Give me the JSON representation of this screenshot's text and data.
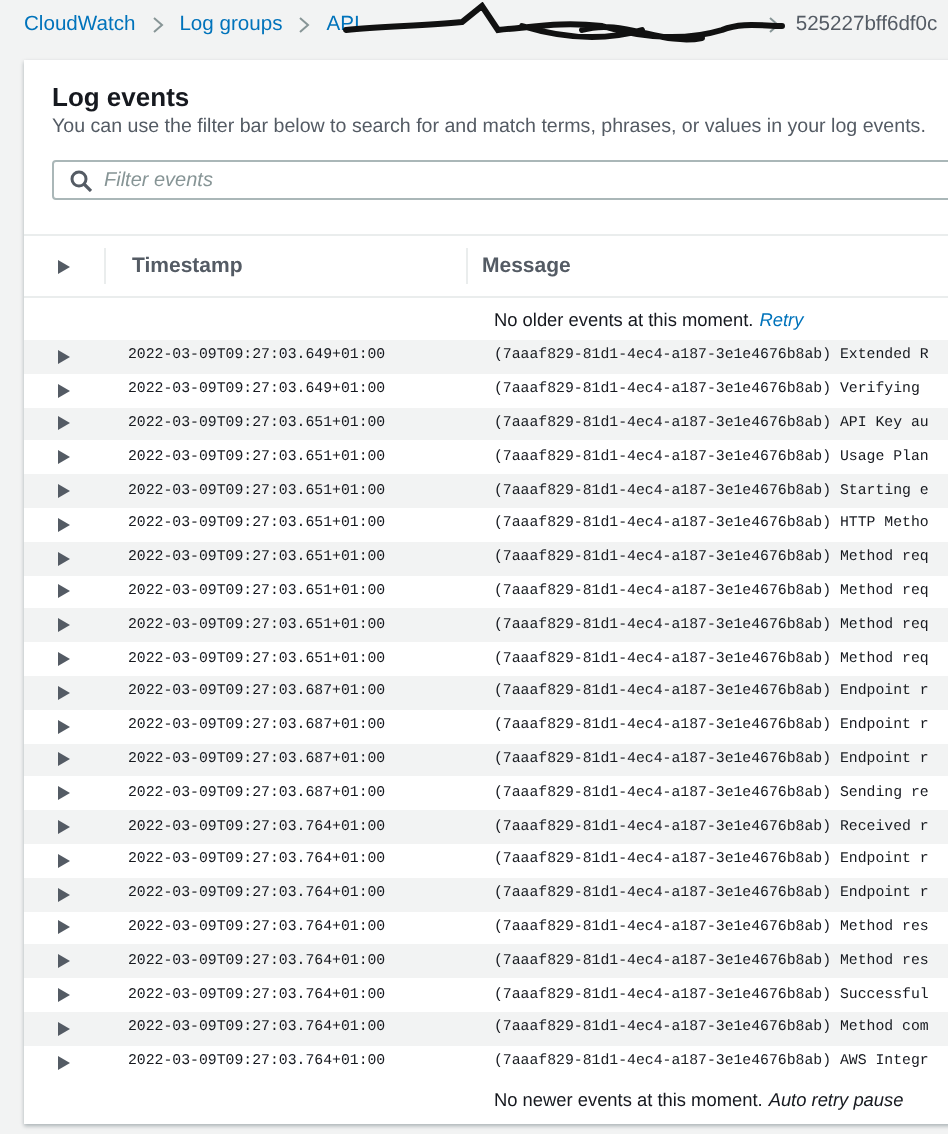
{
  "breadcrumbs": [
    {
      "label": "CloudWatch"
    },
    {
      "label": "Log groups"
    },
    {
      "label": "API"
    },
    {
      "label": "525227bff6df0c"
    }
  ],
  "panel": {
    "title": "Log events",
    "description": "You can use the filter bar below to search for and match terms, phrases, or values in your log events.",
    "filter": {
      "placeholder": "Filter events"
    }
  },
  "table": {
    "columns": [
      "Timestamp",
      "Message"
    ],
    "older_notice": {
      "text": "No older events at this moment.",
      "link": "Retry"
    },
    "rows": [
      {
        "timestamp": "2022-03-09T09:27:03.649+01:00",
        "message": "(7aaaf829-81d1-4ec4-a187-3e1e4676b8ab) Extended R"
      },
      {
        "timestamp": "2022-03-09T09:27:03.649+01:00",
        "message": "(7aaaf829-81d1-4ec4-a187-3e1e4676b8ab) Verifying"
      },
      {
        "timestamp": "2022-03-09T09:27:03.651+01:00",
        "message": "(7aaaf829-81d1-4ec4-a187-3e1e4676b8ab) API Key au"
      },
      {
        "timestamp": "2022-03-09T09:27:03.651+01:00",
        "message": "(7aaaf829-81d1-4ec4-a187-3e1e4676b8ab) Usage Plan"
      },
      {
        "timestamp": "2022-03-09T09:27:03.651+01:00",
        "message": "(7aaaf829-81d1-4ec4-a187-3e1e4676b8ab) Starting e"
      },
      {
        "timestamp": "2022-03-09T09:27:03.651+01:00",
        "message": "(7aaaf829-81d1-4ec4-a187-3e1e4676b8ab) HTTP Metho"
      },
      {
        "timestamp": "2022-03-09T09:27:03.651+01:00",
        "message": "(7aaaf829-81d1-4ec4-a187-3e1e4676b8ab) Method req"
      },
      {
        "timestamp": "2022-03-09T09:27:03.651+01:00",
        "message": "(7aaaf829-81d1-4ec4-a187-3e1e4676b8ab) Method req"
      },
      {
        "timestamp": "2022-03-09T09:27:03.651+01:00",
        "message": "(7aaaf829-81d1-4ec4-a187-3e1e4676b8ab) Method req"
      },
      {
        "timestamp": "2022-03-09T09:27:03.651+01:00",
        "message": "(7aaaf829-81d1-4ec4-a187-3e1e4676b8ab) Method req"
      },
      {
        "timestamp": "2022-03-09T09:27:03.687+01:00",
        "message": "(7aaaf829-81d1-4ec4-a187-3e1e4676b8ab) Endpoint r"
      },
      {
        "timestamp": "2022-03-09T09:27:03.687+01:00",
        "message": "(7aaaf829-81d1-4ec4-a187-3e1e4676b8ab) Endpoint r"
      },
      {
        "timestamp": "2022-03-09T09:27:03.687+01:00",
        "message": "(7aaaf829-81d1-4ec4-a187-3e1e4676b8ab) Endpoint r"
      },
      {
        "timestamp": "2022-03-09T09:27:03.687+01:00",
        "message": "(7aaaf829-81d1-4ec4-a187-3e1e4676b8ab) Sending re"
      },
      {
        "timestamp": "2022-03-09T09:27:03.764+01:00",
        "message": "(7aaaf829-81d1-4ec4-a187-3e1e4676b8ab) Received r"
      },
      {
        "timestamp": "2022-03-09T09:27:03.764+01:00",
        "message": "(7aaaf829-81d1-4ec4-a187-3e1e4676b8ab) Endpoint r"
      },
      {
        "timestamp": "2022-03-09T09:27:03.764+01:00",
        "message": "(7aaaf829-81d1-4ec4-a187-3e1e4676b8ab) Endpoint r"
      },
      {
        "timestamp": "2022-03-09T09:27:03.764+01:00",
        "message": "(7aaaf829-81d1-4ec4-a187-3e1e4676b8ab) Method res"
      },
      {
        "timestamp": "2022-03-09T09:27:03.764+01:00",
        "message": "(7aaaf829-81d1-4ec4-a187-3e1e4676b8ab) Method res"
      },
      {
        "timestamp": "2022-03-09T09:27:03.764+01:00",
        "message": "(7aaaf829-81d1-4ec4-a187-3e1e4676b8ab) Successful"
      },
      {
        "timestamp": "2022-03-09T09:27:03.764+01:00",
        "message": "(7aaaf829-81d1-4ec4-a187-3e1e4676b8ab) Method com"
      },
      {
        "timestamp": "2022-03-09T09:27:03.764+01:00",
        "message": "(7aaaf829-81d1-4ec4-a187-3e1e4676b8ab) AWS Integr"
      }
    ],
    "newer_notice": {
      "text": "No newer events at this moment.",
      "note": "Auto retry pause"
    }
  }
}
